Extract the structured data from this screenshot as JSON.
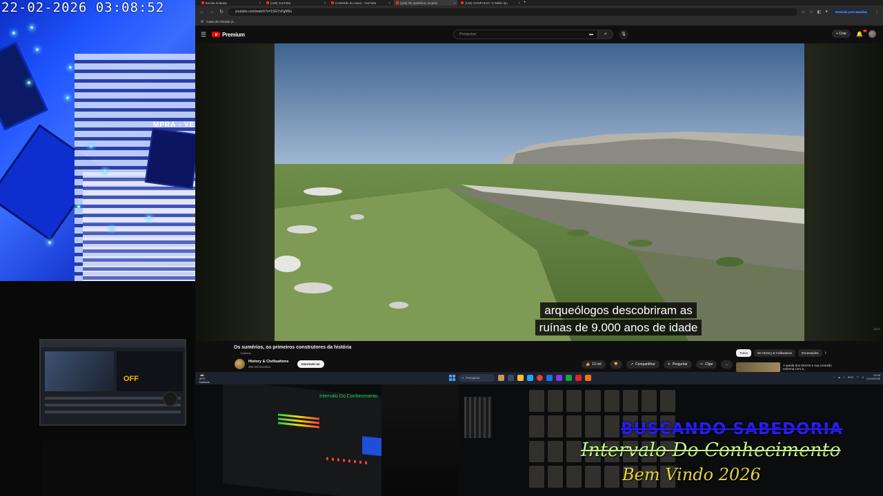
{
  "camera": {
    "timestamp": "22-02-2026  03:08:52",
    "sign_text": "MPRA - VE"
  },
  "browser": {
    "tabs": [
      {
        "label": "Escola Gratuita",
        "active": false
      },
      {
        "label": "(126) YouTube",
        "active": false
      },
      {
        "label": "Conteúdo do canal - YouTube",
        "active": false
      },
      {
        "label": "(126) Os sumérios, os prim",
        "active": true
      },
      {
        "label": "(126) CONFÚCIO: O Sábio Qu",
        "active": false
      }
    ],
    "new_tab": "+",
    "url": "youtube.com/watch?v=1SG7xFgM6o",
    "restart_label": "Reiniciar para atualizar",
    "bookmark": "Caixa de entrada (1..."
  },
  "youtube": {
    "logo": "Premium",
    "search_placeholder": "Pesquisar",
    "create_label": "Criar",
    "notification_count": "9+",
    "captions": [
      "arqueólogos descobriram as",
      "ruínas de 9.000 anos de idade"
    ],
    "video_title": "Os sumérios, os primeiros construtores da história",
    "video_sub": "Dublado",
    "channel_name": "History & Civilisations",
    "channel_subs": "452 mil inscritos",
    "subscribe": "Inscrever-se",
    "likes": "13 mil",
    "share": "Compartilhar",
    "ask": "Perguntar",
    "clips": "Clipe",
    "more": "...",
    "chips": [
      "Todos",
      "De History & Civilisations",
      "Escavações"
    ],
    "recommended": "A queda dos MAIAS e sua conexão extrema com a..."
  },
  "taskbar": {
    "temp": "28°C",
    "weather": "Nublado",
    "search": "Pesquisar",
    "lang": "ENG",
    "time": "03:08",
    "date": "22/02/2026"
  },
  "overlay": {
    "line1": "BUSCANDO SABEDORIA",
    "line2": "Intervalo Do Conhecimento",
    "line3": "Bem Vindo 2026"
  },
  "studio": {
    "monitor_title": "Intervalo Do Conhecimento",
    "mini_monitor_text": "OFF"
  }
}
